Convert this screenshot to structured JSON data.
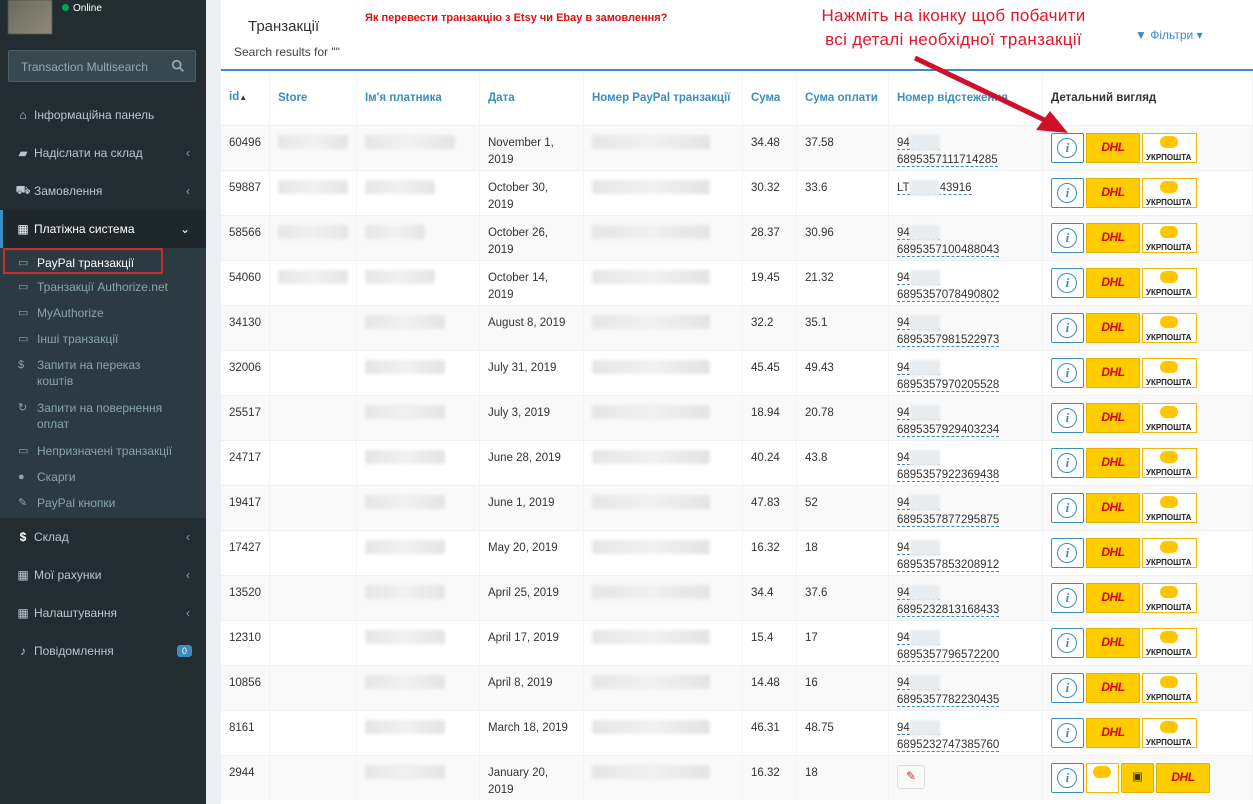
{
  "user": {
    "status": "Online"
  },
  "search": {
    "placeholder": "Transaction Multisearch"
  },
  "menu": {
    "dashboard": "Інформаційна панель",
    "send_to_warehouse": "Надіслати на склад",
    "orders": "Замовлення",
    "payment_system": "Платіжна система",
    "sub": [
      {
        "label": "PayPal транзакції"
      },
      {
        "label": "Транзакції Authorize.net"
      },
      {
        "label": "MyAuthorize"
      },
      {
        "label": "Інші транзакції"
      },
      {
        "label": "Запити на переказ коштів"
      },
      {
        "label": "Запити на повернення оплат"
      },
      {
        "label": "Непризначені транзакції"
      },
      {
        "label": "Скарги"
      },
      {
        "label": "PayPal кнопки"
      }
    ],
    "warehouse": "Склад",
    "my_accounts": "Мої рахунки",
    "settings": "Налаштування",
    "notifications": "Повідомлення",
    "notifications_count": "0"
  },
  "page": {
    "title": "Транзакції",
    "subtitle": "Search results for \"\"",
    "howto_link": "Як перевести транзакцію з Etsy чи Ebay в замовлення?",
    "callout_line1": "Нажміть на іконку щоб побачити",
    "callout_line2": "всі деталі необхідної транзакції",
    "filters": "Фільтри"
  },
  "table": {
    "headers": [
      "id",
      "Store",
      "Ім'я платника",
      "Дата",
      "Номер PayPal транзакції",
      "Сума",
      "Сума оплати",
      "Номер відстеження",
      "Детальний вигляд"
    ],
    "labels": {
      "info": "i",
      "dhl": "DHL",
      "ukrposhta": "УКРПОШТА"
    },
    "rows": [
      {
        "id": "60496",
        "date": "November 1, 2019",
        "sum": "34.48",
        "paid": "37.58",
        "t_pre": "94",
        "t_suf": "6895357111714285"
      },
      {
        "id": "59887",
        "date": "October 30, 2019",
        "sum": "30.32",
        "paid": "33.6",
        "t_pre": "LT",
        "t_suf": "43916"
      },
      {
        "id": "58566",
        "date": "October 26, 2019",
        "sum": "28.37",
        "paid": "30.96",
        "t_pre": "94",
        "t_suf": "6895357100488043"
      },
      {
        "id": "54060",
        "date": "October 14, 2019",
        "sum": "19.45",
        "paid": "21.32",
        "t_pre": "94",
        "t_suf": "6895357078490802"
      },
      {
        "id": "34130",
        "date": "August 8, 2019",
        "sum": "32.2",
        "paid": "35.1",
        "t_pre": "94",
        "t_suf": "6895357981522973"
      },
      {
        "id": "32006",
        "date": "July 31, 2019",
        "sum": "45.45",
        "paid": "49.43",
        "t_pre": "94",
        "t_suf": "6895357970205528"
      },
      {
        "id": "25517",
        "date": "July 3, 2019",
        "sum": "18.94",
        "paid": "20.78",
        "t_pre": "94",
        "t_suf": "6895357929403234"
      },
      {
        "id": "24717",
        "date": "June 28, 2019",
        "sum": "40.24",
        "paid": "43.8",
        "t_pre": "94",
        "t_suf": "6895357922369438"
      },
      {
        "id": "19417",
        "date": "June 1, 2019",
        "sum": "47.83",
        "paid": "52",
        "t_pre": "94",
        "t_suf": "6895357877295875"
      },
      {
        "id": "17427",
        "date": "May 20, 2019",
        "sum": "16.32",
        "paid": "18",
        "t_pre": "94",
        "t_suf": "6895357853208912"
      },
      {
        "id": "13520",
        "date": "April 25, 2019",
        "sum": "34.4",
        "paid": "37.6",
        "t_pre": "94",
        "t_suf": "6895232813168433"
      },
      {
        "id": "12310",
        "date": "April 17, 2019",
        "sum": "15.4",
        "paid": "17",
        "t_pre": "94",
        "t_suf": "6895357796572200"
      },
      {
        "id": "10856",
        "date": "April 8, 2019",
        "sum": "14.48",
        "paid": "16",
        "t_pre": "94",
        "t_suf": "6895357782230435"
      },
      {
        "id": "8161",
        "date": "March 18, 2019",
        "sum": "46.31",
        "paid": "48.75",
        "t_pre": "94",
        "t_suf": "6895232747385760"
      },
      {
        "id": "2944",
        "date": "January 20, 2019",
        "sum": "16.32",
        "paid": "18",
        "t_pre": "",
        "t_suf": ""
      }
    ]
  },
  "colors": {
    "accent": "#3c8dbc",
    "sidebar": "#222d32",
    "highlight": "#c9302c",
    "dhl": "#ffcc00"
  }
}
